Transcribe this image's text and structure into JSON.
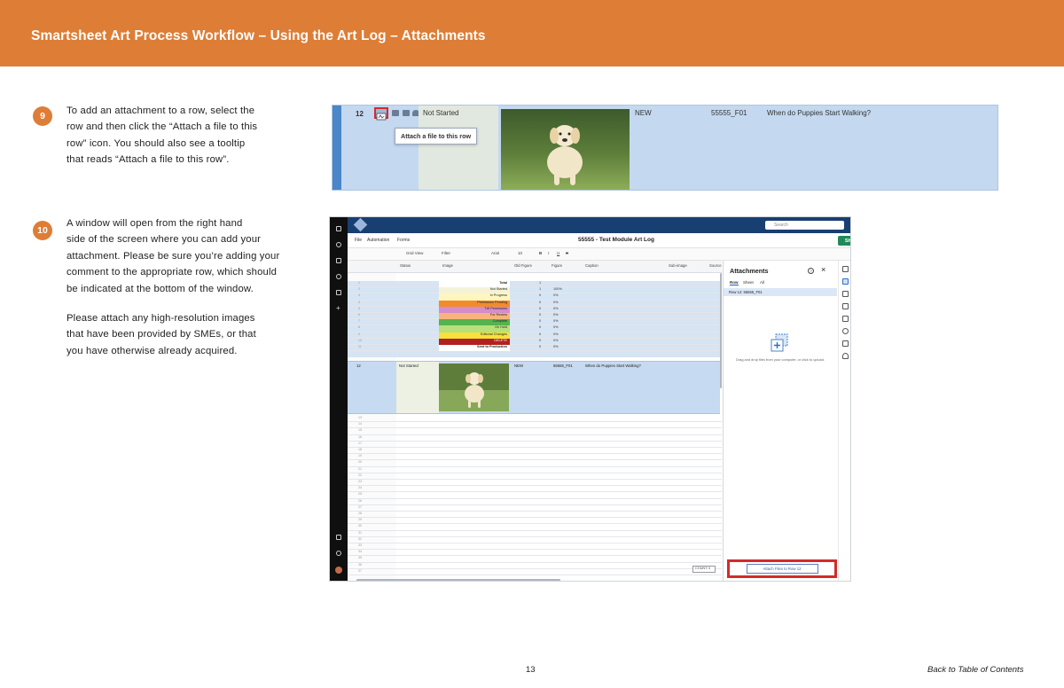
{
  "header": {
    "title": "Smartsheet Art Process Workflow – Using the Art Log – Attachments"
  },
  "steps": [
    {
      "number": "9",
      "lines": [
        "To add an attachment to a row, select the",
        "row and then click the “Attach a file to this",
        "row” icon. You should also see a tooltip",
        "that reads “Attach a file to this row”."
      ]
    },
    {
      "number": "10",
      "lines": [
        "A window will open from the right hand",
        "side of the screen where you can add your",
        "attachment. Please be sure you’re adding your",
        "comment to the appropriate row, which should",
        "be indicated at the bottom of the window."
      ],
      "lines2": [
        "Please attach any high-resolution images",
        "that have been provided by SMEs, or that",
        "you have otherwise already acquired."
      ]
    }
  ],
  "shot1": {
    "row_number": "12",
    "tooltip": "Attach a file to this row",
    "status": "Not Started",
    "new": "NEW",
    "figure": "55555_F01",
    "caption": "When do Puppies Start Walking?",
    "colors": {
      "row": "#c4d8ef",
      "status_col": "#e1e8df",
      "highlight": "#d32b2b"
    }
  },
  "shot2": {
    "search_placeholder": "Search",
    "menu": [
      "File",
      "Automation",
      "Forms"
    ],
    "doc_title": "55555 - Test Module Art Log",
    "share": "Share",
    "toolbar": [
      "Grid View",
      "Filter",
      "Arial",
      "10",
      "B",
      "I",
      "U",
      "S"
    ],
    "columns": [
      "Status",
      "Image",
      "Old Figure",
      "Figure",
      "Caption",
      "Sub-image",
      "Source"
    ],
    "status_rows": [
      {
        "label": "Total",
        "bg": "#ffffff",
        "count": "1",
        "pct": ""
      },
      {
        "label": "Not Started",
        "bg": "#f4f3d8",
        "count": "1",
        "pct": "100%"
      },
      {
        "label": "In Progress",
        "bg": "#fff6bf",
        "count": "0",
        "pct": "0%"
      },
      {
        "label": "Permission Pending",
        "bg": "#f28b2c",
        "count": "0",
        "pct": "0%"
      },
      {
        "label": "TW Permission",
        "bg": "#d48ccc",
        "count": "0",
        "pct": "0%"
      },
      {
        "label": "For Review",
        "bg": "#f6b47c",
        "count": "0",
        "pct": "0%"
      },
      {
        "label": "Complete",
        "bg": "#55b24f",
        "count": "0",
        "pct": "0%"
      },
      {
        "label": "On Hold",
        "bg": "#b9e07a",
        "count": "0",
        "pct": "0%"
      },
      {
        "label": "Editorial Changes",
        "bg": "#f7e13a",
        "count": "0",
        "pct": "0%"
      },
      {
        "label": "DELETE",
        "bg": "#b32020",
        "count": "0",
        "pct": "0%"
      },
      {
        "label": "Sent to Production",
        "bg": "#ffffff",
        "count": "0",
        "pct": "0%"
      }
    ],
    "big_row": {
      "num": "12",
      "status": "Not Started",
      "new": "NEW",
      "figure": "55555_F01",
      "caption": "When do Puppies Start Walking?"
    },
    "count_label": "COUNT: 0",
    "panel": {
      "title": "Attachments",
      "tabs": [
        "Row",
        "Sheet",
        "All"
      ],
      "row_label": "Row 12: 55555_F01",
      "drop_text": "Drag and drop files from your computer, or click to upload.",
      "attach_button": "Attach Files to Row 12"
    }
  },
  "footer": {
    "page_number": "13",
    "back_link": "Back to Table of Contents"
  }
}
